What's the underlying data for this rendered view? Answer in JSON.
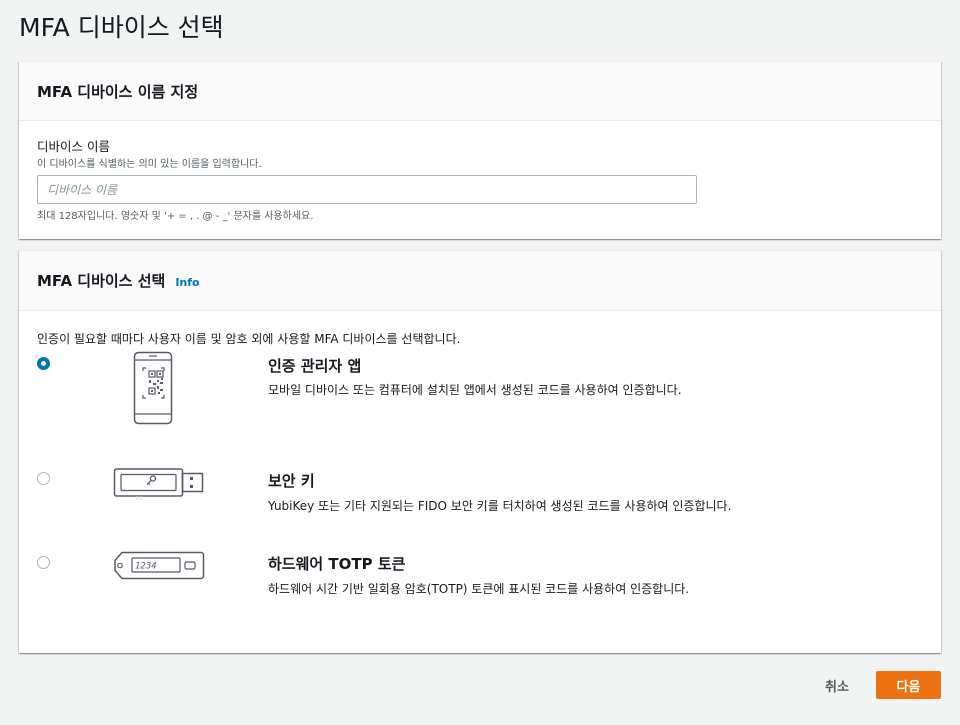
{
  "page": {
    "title": "MFA 디바이스 선택"
  },
  "name_section": {
    "title": "MFA 디바이스 이름 지정",
    "field_label": "디바이스 이름",
    "field_description": "이 디바이스를 식별하는 의미 있는 이름을 입력합니다.",
    "input_value": "",
    "input_placeholder": "디바이스 이름",
    "constraint": "최대 128자입니다. 영숫자 및 '+ = , . @ - _' 문자를 사용하세요."
  },
  "device_section": {
    "title": "MFA 디바이스 선택",
    "info_link": "Info",
    "description": "인증이 필요할 때마다 사용자 이름 및 암호 외에 사용할 MFA 디바이스를 선택합니다.",
    "selected": "authenticator",
    "options": [
      {
        "id": "authenticator",
        "title": "인증 관리자 앱",
        "description": "모바일 디바이스 또는 컴퓨터에 설치된 앱에서 생성된 코드를 사용하여 인증합니다.",
        "icon": "phone-qr-icon"
      },
      {
        "id": "security-key",
        "title": "보안 키",
        "description": "YubiKey 또는 기타 지원되는 FIDO 보안 키를 터치하여 생성된 코드를 사용하여 인증합니다.",
        "icon": "usb-key-icon"
      },
      {
        "id": "totp",
        "title": "하드웨어 TOTP 토큰",
        "description": "하드웨어 시간 기반 일회용 암호(TOTP) 토큰에 표시된 코드를 사용하여 인증합니다.",
        "icon": "totp-token-icon",
        "token_display": "1234"
      }
    ]
  },
  "footer": {
    "cancel_label": "취소",
    "next_label": "다음"
  },
  "colors": {
    "accent": "#0073bb",
    "primary_button": "#ec7211",
    "background": "#f2f3f3"
  }
}
